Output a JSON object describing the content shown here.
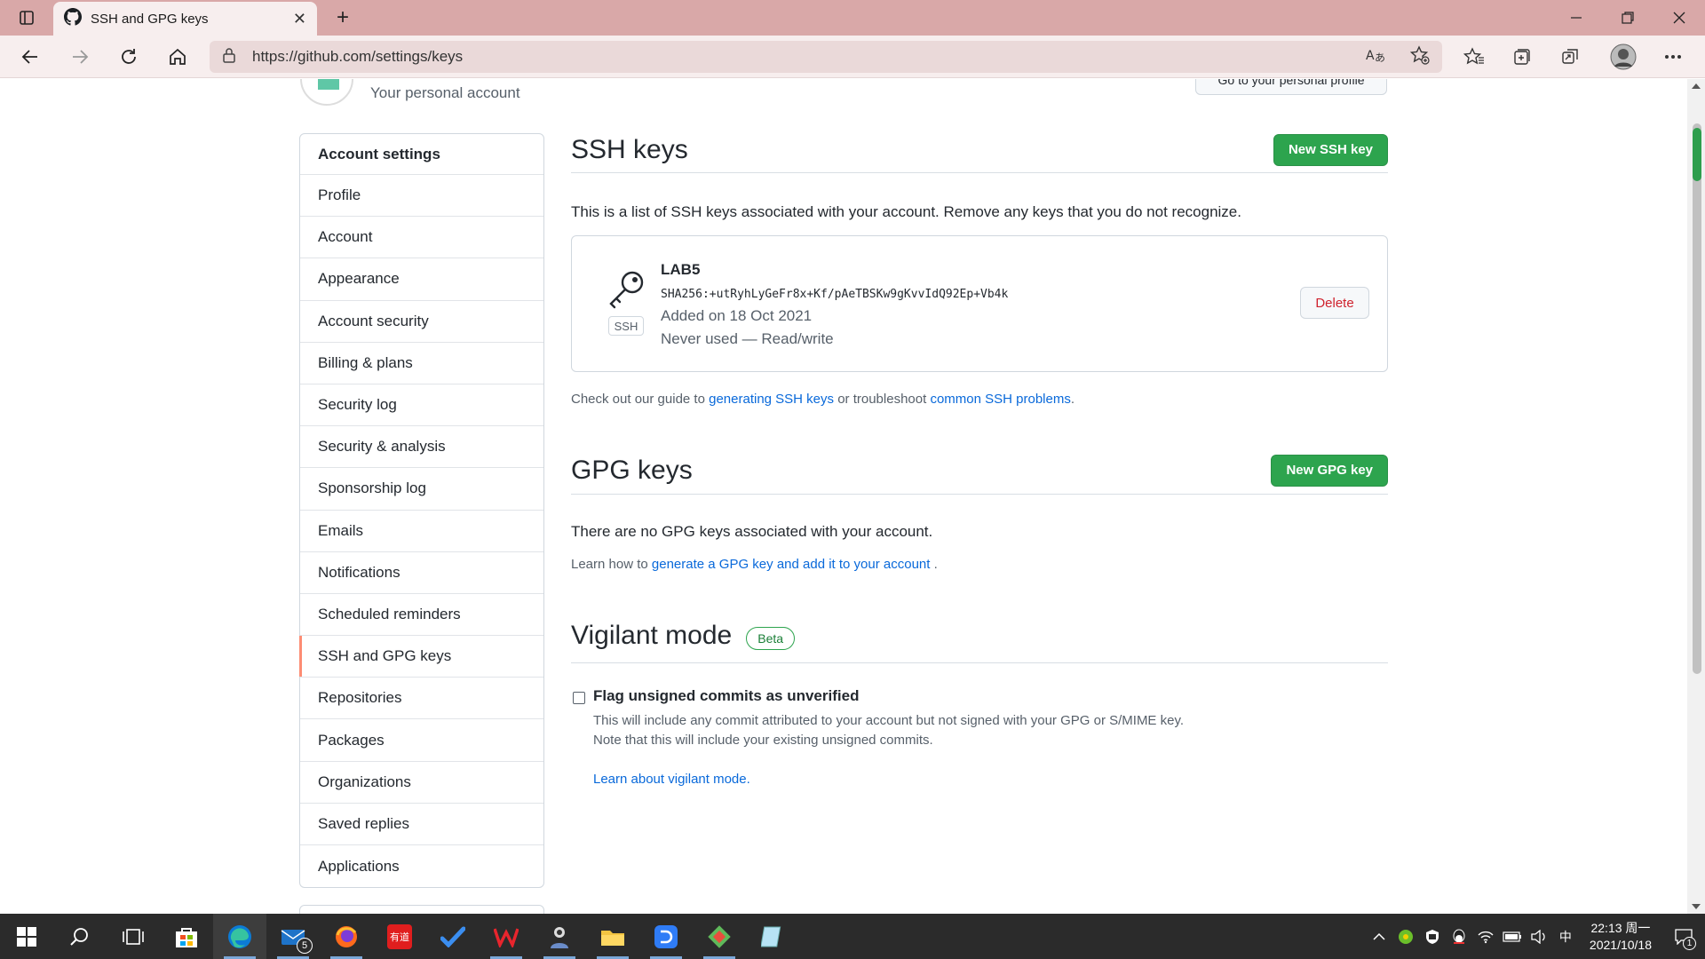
{
  "browser": {
    "tab_title": "SSH and GPG keys",
    "url": "https://github.com/settings/keys",
    "new_tab_symbol": "+",
    "close_symbol": "✕"
  },
  "header": {
    "personal_account": "Your personal account",
    "go_profile": "Go to your personal profile"
  },
  "sidebar": {
    "heading": "Account settings",
    "items": [
      {
        "label": "Profile"
      },
      {
        "label": "Account"
      },
      {
        "label": "Appearance"
      },
      {
        "label": "Account security"
      },
      {
        "label": "Billing & plans"
      },
      {
        "label": "Security log"
      },
      {
        "label": "Security & analysis"
      },
      {
        "label": "Sponsorship log"
      },
      {
        "label": "Emails"
      },
      {
        "label": "Notifications"
      },
      {
        "label": "Scheduled reminders"
      },
      {
        "label": "SSH and GPG keys",
        "active": true
      },
      {
        "label": "Repositories"
      },
      {
        "label": "Packages"
      },
      {
        "label": "Organizations"
      },
      {
        "label": "Saved replies"
      },
      {
        "label": "Applications"
      }
    ]
  },
  "ssh": {
    "title": "SSH keys",
    "new_button": "New SSH key",
    "description": "This is a list of SSH keys associated with your account. Remove any keys that you do not recognize.",
    "key": {
      "badge": "SSH",
      "name": "LAB5",
      "fingerprint": "SHA256:+utRyhLyGeFr8x+Kf/pAeTBSKw9gKvvIdQ92Ep+Vb4k",
      "added": "Added on 18 Oct 2021",
      "usage": "Never used — Read/write",
      "delete_button": "Delete"
    },
    "guide_prefix": "Check out our guide to",
    "guide_link1": "generating SSH keys",
    "guide_mid": "or troubleshoot",
    "guide_link2": "common SSH problems",
    "guide_suffix": "."
  },
  "gpg": {
    "title": "GPG keys",
    "new_button": "New GPG key",
    "empty": "There are no GPG keys associated with your account.",
    "learn_prefix": "Learn how to",
    "learn_link": "generate a GPG key and add it to your account",
    "learn_suffix": "."
  },
  "vigilant": {
    "title": "Vigilant mode",
    "badge": "Beta",
    "checkbox_label": "Flag unsigned commits as unverified",
    "checked": false,
    "note1": "This will include any commit attributed to your account but not signed with your GPG or S/MIME key.",
    "note2": "Note that this will include your existing unsigned commits.",
    "learn_link": "Learn about vigilant mode."
  },
  "taskbar": {
    "time": "22:13 周一",
    "date": "2021/10/18",
    "ime": "中",
    "mail_badge": "5",
    "notif_badge": "1",
    "youdao": "有道"
  },
  "colors": {
    "green": "#2da44e",
    "link": "#0969da",
    "danger": "#cf222e",
    "active_marker": "#fd8c73",
    "titlebar": "#d9a8a8"
  }
}
